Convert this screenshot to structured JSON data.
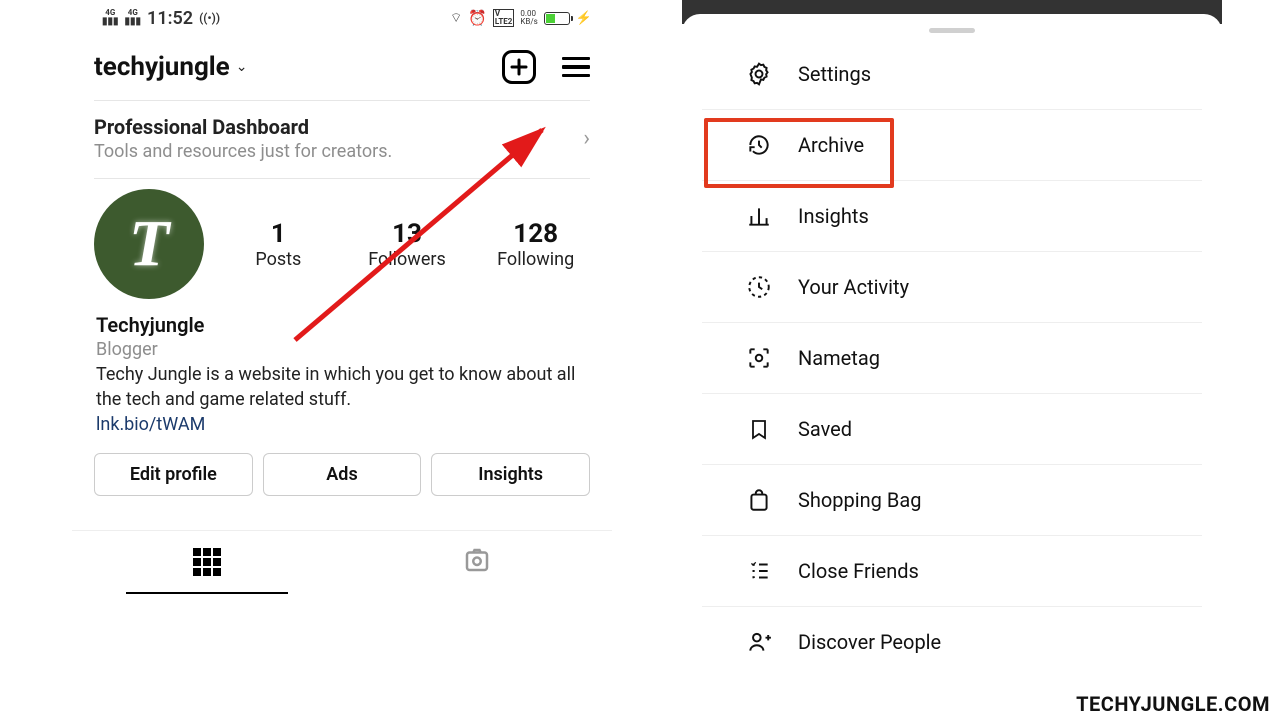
{
  "status": {
    "time": "11:52",
    "net1": "4G",
    "net2": "4G",
    "lte": "LTE2",
    "speed": "0.00\nKB/s"
  },
  "profile": {
    "username": "techyjungle",
    "dashboard_title": "Professional Dashboard",
    "dashboard_sub": "Tools and resources just for creators.",
    "posts_count": "1",
    "posts_label": "Posts",
    "followers_count": "13",
    "followers_label": "Followers",
    "following_count": "128",
    "following_label": "Following",
    "display_name": "Techyjungle",
    "category": "Blogger",
    "bio_text": "Techy Jungle is a website in which you get to know about all the tech and game related stuff.",
    "link": "lnk.bio/tWAM",
    "btn_edit": "Edit profile",
    "btn_ads": "Ads",
    "btn_insights": "Insights"
  },
  "menu": {
    "items": [
      {
        "label": "Settings",
        "icon": "settings-icon"
      },
      {
        "label": "Archive",
        "icon": "archive-icon",
        "highlighted": true
      },
      {
        "label": "Insights",
        "icon": "insights-icon"
      },
      {
        "label": "Your Activity",
        "icon": "activity-icon"
      },
      {
        "label": "Nametag",
        "icon": "nametag-icon"
      },
      {
        "label": "Saved",
        "icon": "saved-icon"
      },
      {
        "label": "Shopping Bag",
        "icon": "shopping-icon"
      },
      {
        "label": "Close Friends",
        "icon": "close-friends-icon"
      },
      {
        "label": "Discover People",
        "icon": "discover-icon"
      }
    ]
  },
  "watermark": "TECHYJUNGLE.COM",
  "avatar_letter": "T"
}
